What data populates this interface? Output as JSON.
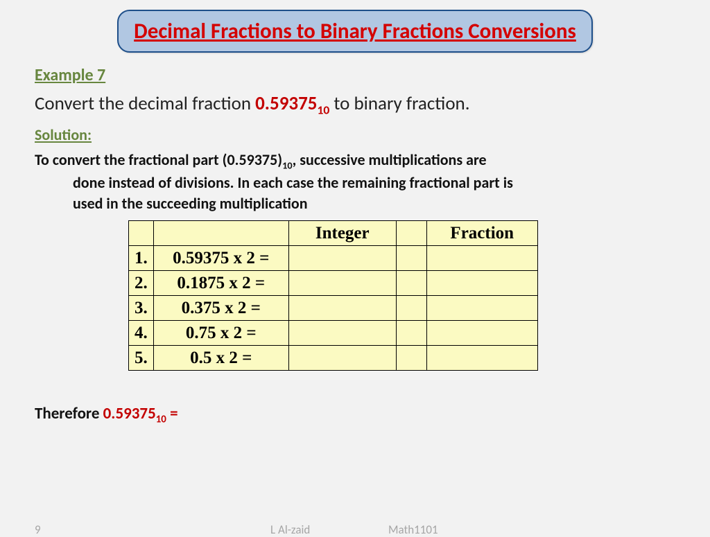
{
  "title": "Decimal Fractions to Binary Fractions Conversions",
  "example_label": "Example 7",
  "convert": {
    "pre": "Convert the decimal fraction ",
    "value": "0.59375",
    "base": "10",
    "post": "  to binary fraction."
  },
  "solution_label": "Solution:",
  "explain": {
    "l1a": "To convert the fractional part (0.59375)",
    "l1sub": "10",
    "l1b": ", successive multiplications are",
    "l2": "done instead of divisions.  In each case the remaining fractional part is",
    "l3": "used in the succeeding multiplication"
  },
  "table": {
    "headers": {
      "integer": "Integer",
      "fraction": "Fraction"
    },
    "rows": [
      {
        "n": "1.",
        "expr": "0.59375 x 2 =",
        "int": "",
        "frac": ""
      },
      {
        "n": "2.",
        "expr": "0.1875 x 2 =",
        "int": "",
        "frac": ""
      },
      {
        "n": "3.",
        "expr": "0.375 x 2 =",
        "int": "",
        "frac": ""
      },
      {
        "n": "4.",
        "expr": "0.75 x 2 =",
        "int": "",
        "frac": ""
      },
      {
        "n": "5.",
        "expr": "0.5 x 2 =",
        "int": "",
        "frac": ""
      }
    ]
  },
  "therefore": {
    "label": "Therefore ",
    "value": "0.59375",
    "base": "10",
    "eq": " ="
  },
  "footer": {
    "page": "9",
    "author": "L Al-zaid",
    "course": "Math1101"
  }
}
